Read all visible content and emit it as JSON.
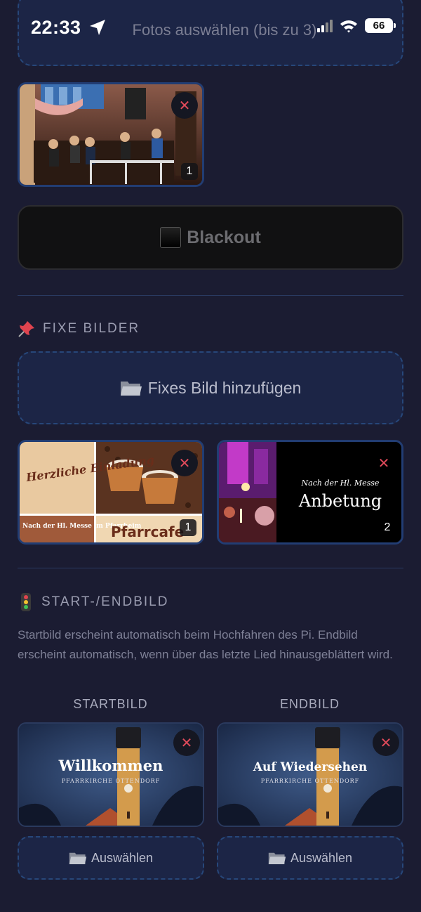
{
  "status_bar": {
    "time": "22:33",
    "battery": "66"
  },
  "upload": {
    "label": "Fotos auswählen (bis zu 3)"
  },
  "selected_photos": [
    {
      "badge": "1"
    }
  ],
  "blackout": {
    "label": "Blackout"
  },
  "fixed_images": {
    "title": "FIXE BILDER",
    "add_label": "Fixes Bild hinzufügen",
    "items": [
      {
        "badge": "1",
        "text_top": "Herzliche Einladung",
        "text_bottom": "Nach der Hl. Messe im Pfarrheim",
        "text_brand": "Pfarrcafe"
      },
      {
        "badge": "2",
        "text_small": "Nach der Hl. Messe",
        "text_big": "Anbetung"
      }
    ]
  },
  "start_end": {
    "title": "START-/ENDBILD",
    "description": "Startbild erscheint automatisch beim Hochfahren des Pi. Endbild erscheint automatisch, wenn über das letzte Lied hinausgeblättert wird.",
    "start": {
      "label": "STARTBILD",
      "title": "Willkommen",
      "subtitle": "PFARRKIRCHE OTTENDORF",
      "button": "Auswählen"
    },
    "end": {
      "label": "ENDBILD",
      "title": "Auf Wiedersehen",
      "subtitle": "PFARRKIRCHE OTTENDORF",
      "button": "Auswählen"
    }
  },
  "colors": {
    "background": "#1b1c32",
    "accent_border": "#27477a",
    "close_x": "#e04a5a"
  }
}
